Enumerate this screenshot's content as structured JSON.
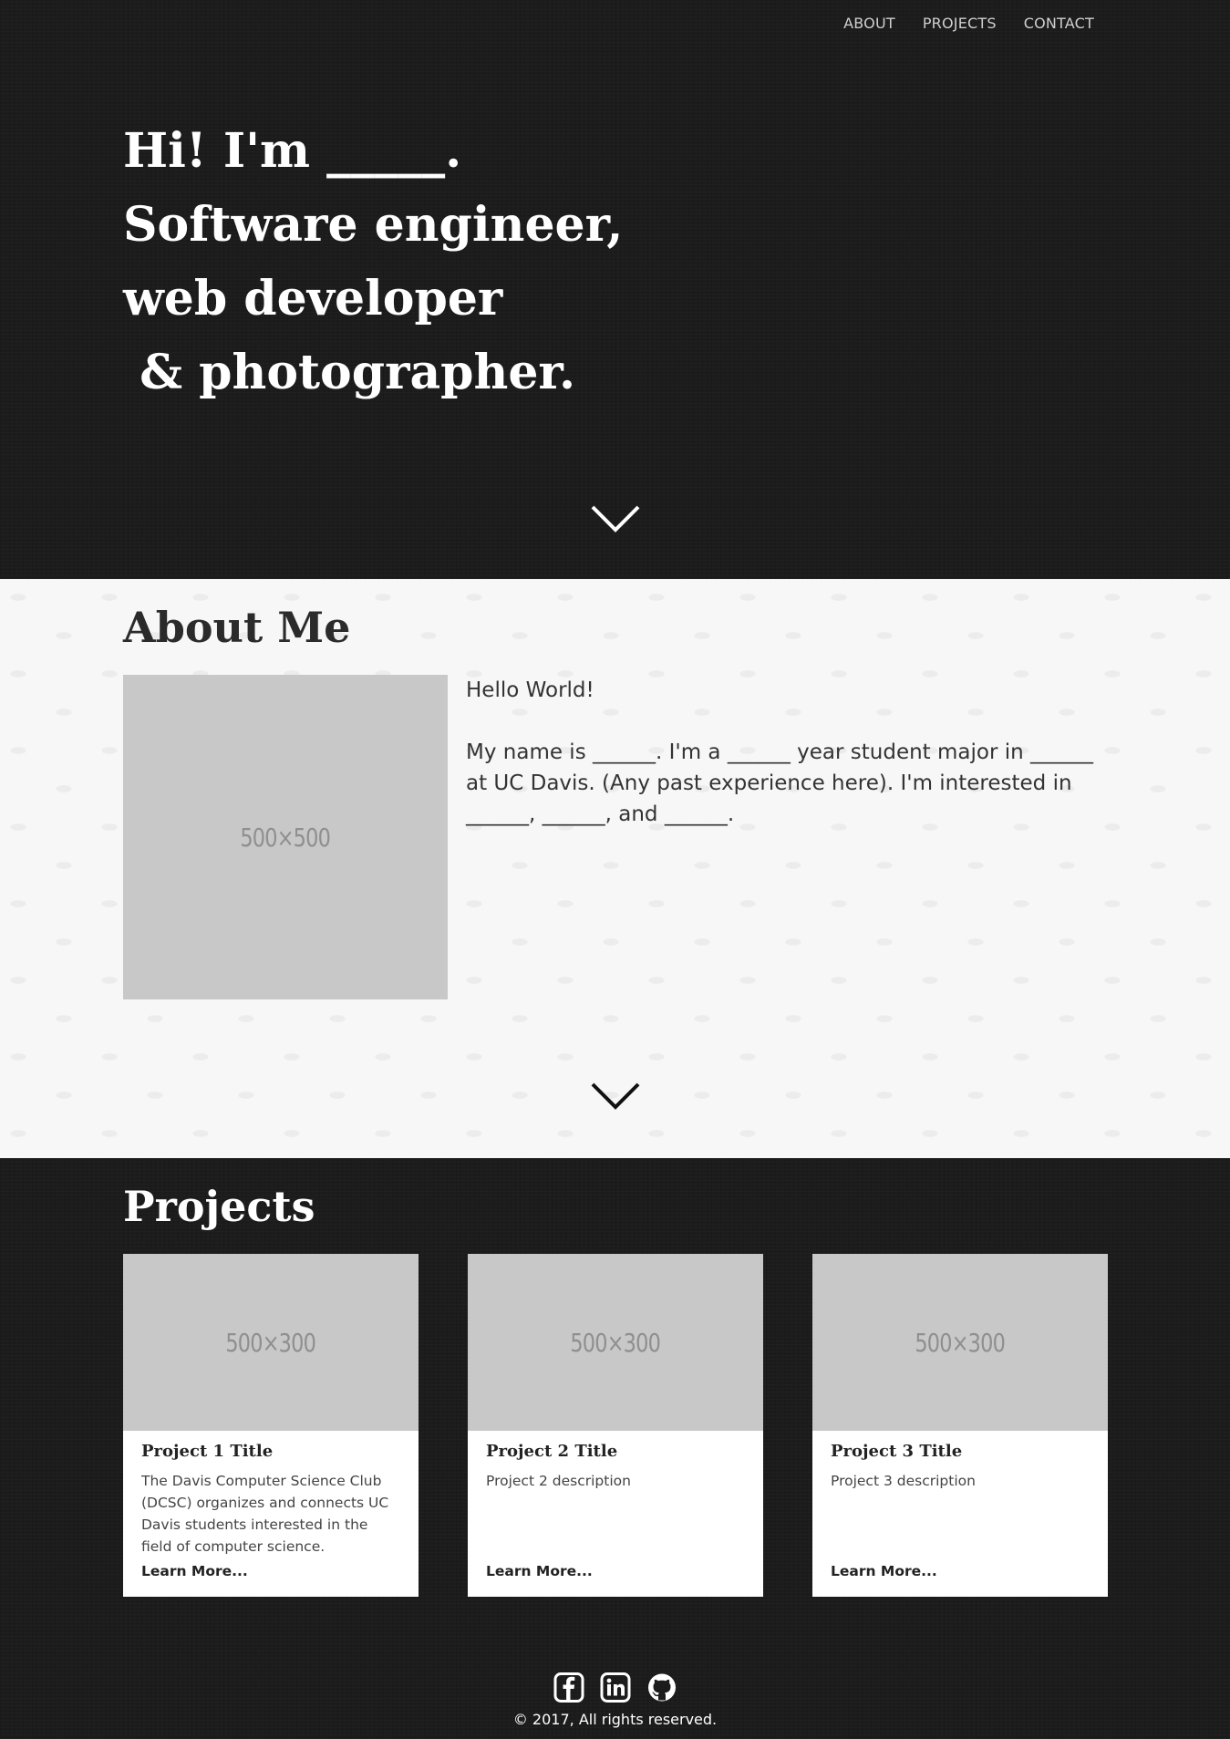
{
  "nav": {
    "items": [
      {
        "label": "ABOUT"
      },
      {
        "label": "PROJECTS"
      },
      {
        "label": "CONTACT"
      }
    ]
  },
  "hero": {
    "lines": [
      "Hi! I'm _____.",
      "Software engineer,",
      "web developer",
      " & photographer."
    ],
    "chevron_icon": "chevron-down-icon"
  },
  "about": {
    "title": "About Me",
    "image_placeholder": "500×500",
    "greeting": "Hello World!",
    "bio": "My name is ______. I'm a ______ year student major in ______ at UC Davis. (Any past experience here). I'm interested in ______, ______, and ______.",
    "chevron_icon": "chevron-down-icon"
  },
  "projects": {
    "title": "Projects",
    "items": [
      {
        "image_placeholder": "500×300",
        "title": "Project 1 Title",
        "description": "The Davis Computer Science Club (DCSC) organizes and connects UC Davis students interested in the field of computer science.",
        "link": "Learn More..."
      },
      {
        "image_placeholder": "500×300",
        "title": "Project 2 Title",
        "description": "Project 2 description",
        "link": "Learn More..."
      },
      {
        "image_placeholder": "500×300",
        "title": "Project 3 Title",
        "description": "Project 3 description",
        "link": "Learn More..."
      }
    ]
  },
  "footer": {
    "icons": [
      "facebook-icon",
      "linkedin-icon",
      "github-icon"
    ],
    "copyright": "© 2017, All rights reserved."
  },
  "colors": {
    "dark_bg": "#1c1c1c",
    "light_bg": "#f7f7f7",
    "placeholder": "#c8c8c8",
    "text_light": "#ffffff",
    "text_dark": "#2b2b2b"
  }
}
